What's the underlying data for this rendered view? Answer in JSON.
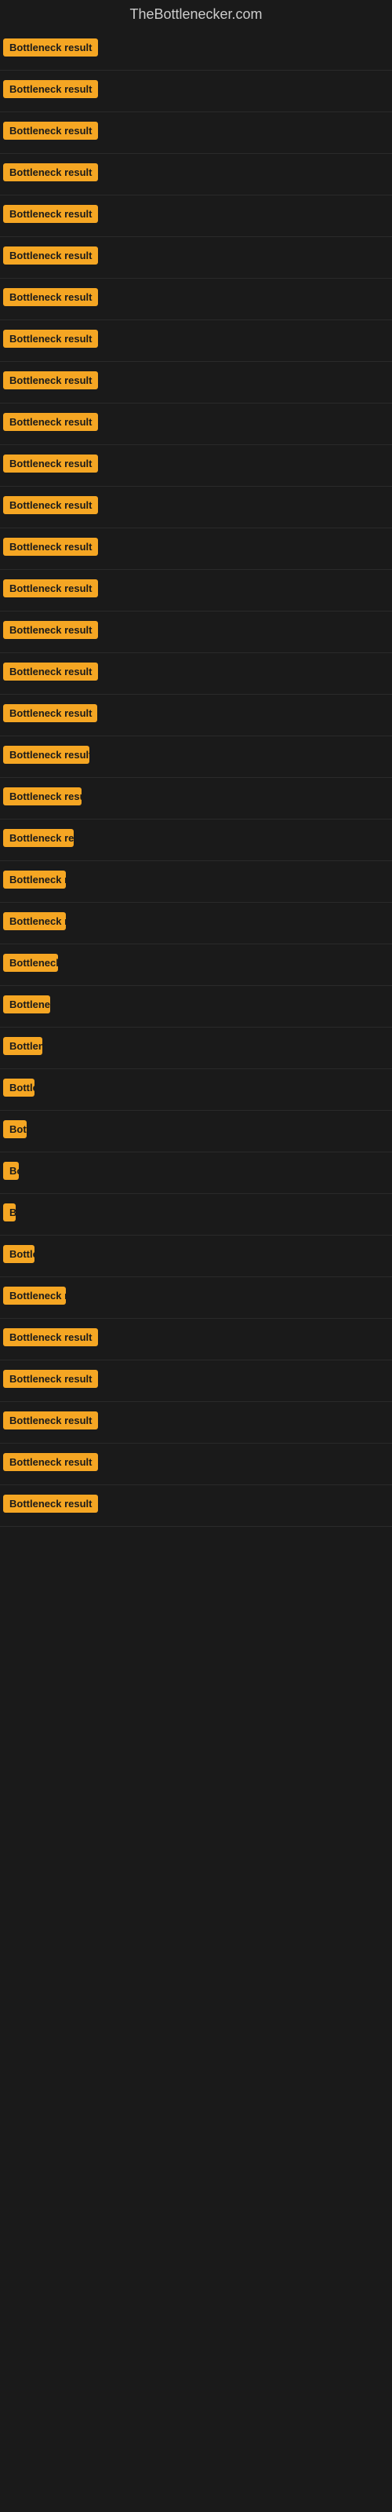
{
  "site": {
    "title": "TheBottlenecker.com"
  },
  "badge_label": "Bottleneck result",
  "rows": [
    {
      "id": 1,
      "width_class": "badge-full"
    },
    {
      "id": 2,
      "width_class": "badge-full"
    },
    {
      "id": 3,
      "width_class": "badge-full"
    },
    {
      "id": 4,
      "width_class": "badge-full"
    },
    {
      "id": 5,
      "width_class": "badge-full"
    },
    {
      "id": 6,
      "width_class": "badge-full"
    },
    {
      "id": 7,
      "width_class": "badge-full"
    },
    {
      "id": 8,
      "width_class": "badge-full"
    },
    {
      "id": 9,
      "width_class": "badge-full"
    },
    {
      "id": 10,
      "width_class": "badge-full"
    },
    {
      "id": 11,
      "width_class": "badge-full"
    },
    {
      "id": 12,
      "width_class": "badge-full"
    },
    {
      "id": 13,
      "width_class": "badge-full"
    },
    {
      "id": 14,
      "width_class": "badge-full"
    },
    {
      "id": 15,
      "width_class": "badge-full"
    },
    {
      "id": 16,
      "width_class": "badge-w130"
    },
    {
      "id": 17,
      "width_class": "badge-w120"
    },
    {
      "id": 18,
      "width_class": "badge-w110"
    },
    {
      "id": 19,
      "width_class": "badge-w100"
    },
    {
      "id": 20,
      "width_class": "badge-w90"
    },
    {
      "id": 21,
      "width_class": "badge-w80"
    },
    {
      "id": 22,
      "width_class": "badge-w80"
    },
    {
      "id": 23,
      "width_class": "badge-w70"
    },
    {
      "id": 24,
      "width_class": "badge-w60"
    },
    {
      "id": 25,
      "width_class": "badge-w50"
    },
    {
      "id": 26,
      "width_class": "badge-w40"
    },
    {
      "id": 27,
      "width_class": "badge-w30"
    },
    {
      "id": 28,
      "width_class": "badge-w20"
    },
    {
      "id": 29,
      "width_class": "badge-w15"
    },
    {
      "id": 30,
      "width_class": "badge-w40"
    },
    {
      "id": 31,
      "width_class": "badge-w80"
    },
    {
      "id": 32,
      "width_class": "badge-full"
    },
    {
      "id": 33,
      "width_class": "badge-full"
    },
    {
      "id": 34,
      "width_class": "badge-full"
    },
    {
      "id": 35,
      "width_class": "badge-full"
    },
    {
      "id": 36,
      "width_class": "badge-full"
    }
  ]
}
